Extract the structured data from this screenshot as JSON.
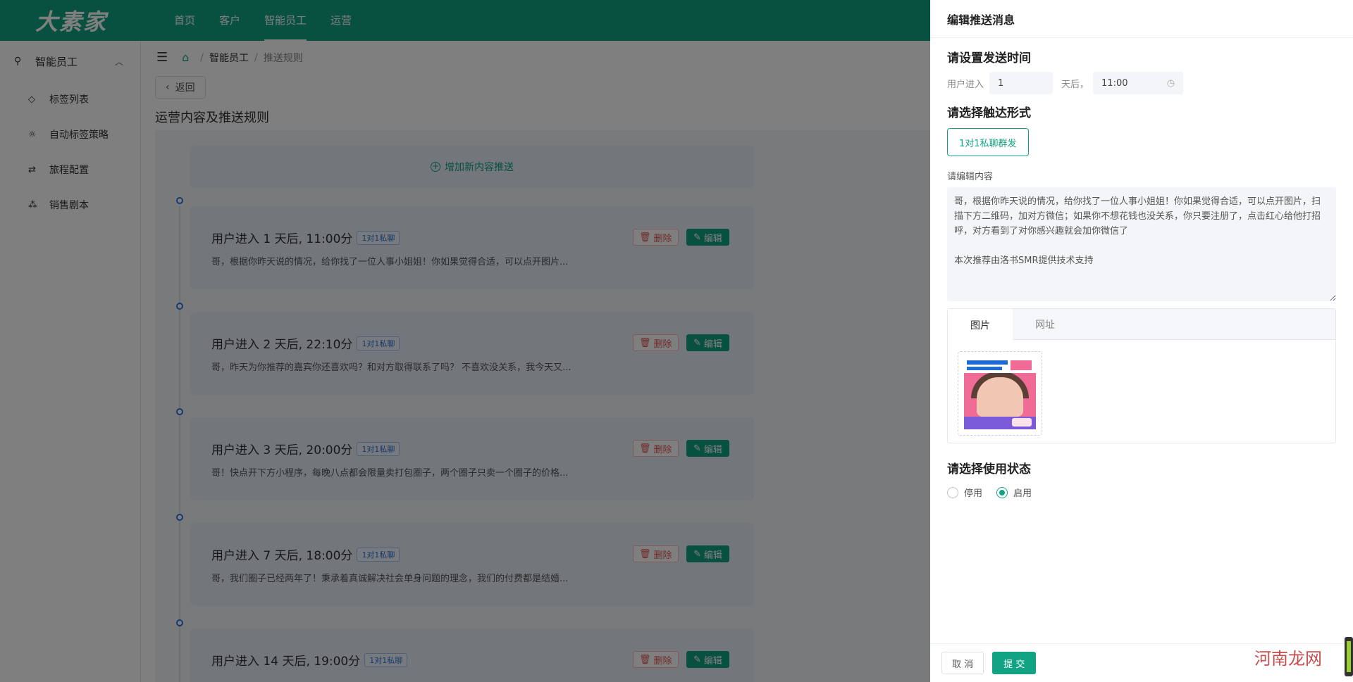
{
  "app": {
    "logo": "大素家",
    "top_nav": [
      "首页",
      "客户",
      "智能员工",
      "运营"
    ],
    "active_nav": "智能员工"
  },
  "sidebar": {
    "group": "智能员工",
    "items": [
      {
        "label": "标签列表",
        "icon": "tag-icon"
      },
      {
        "label": "自动标签策略",
        "icon": "bulb-icon"
      },
      {
        "label": "旅程配置",
        "icon": "route-icon"
      },
      {
        "label": "销售剧本",
        "icon": "tree-icon"
      }
    ]
  },
  "breadcrumb": [
    "智能员工",
    "推送规则"
  ],
  "back_label": "返回",
  "page_title": "运营内容及推送规则",
  "add_push_label": "增加新内容推送",
  "push_cards": [
    {
      "title": "用户进入 1 天后, 11:00分",
      "tag": "1对1私聊",
      "desc": "哥，根据你昨天说的情况，给你找了一位人事小姐姐！你如果觉得合适，可以点开图片..."
    },
    {
      "title": "用户进入 2 天后, 22:10分",
      "tag": "1对1私聊",
      "desc": "哥，昨天为你推荐的嘉宾你还喜欢吗？和对方取得联系了吗？ 不喜欢没关系，我今天又..."
    },
    {
      "title": "用户进入 3 天后, 20:00分",
      "tag": "1对1私聊",
      "desc": "哥！快点开下方小程序，每晚八点都会限量卖打包圈子，两个圈子只卖一个圈子的价格..."
    },
    {
      "title": "用户进入 7 天后, 18:00分",
      "tag": "1对1私聊",
      "desc": "哥，我们圈子已经两年了！秉承着真诚解决社会单身问题的理念，我们的付费都是结婚..."
    },
    {
      "title": "用户进入 14 天后, 19:00分",
      "tag": "1对1私聊",
      "desc": ""
    }
  ],
  "card_actions": {
    "delete": "删除",
    "edit": "编辑"
  },
  "drawer": {
    "title": "编辑推送消息",
    "time_section": "请设置发送时间",
    "user_enter_label": "用户进入",
    "days_value": "1",
    "days_after_label": "天后，",
    "time_value": "11:00",
    "touch_section": "请选择触达形式",
    "touch_option": "1对1私聊群发",
    "content_label": "请编辑内容",
    "content_text": "哥，根据你昨天说的情况，给你找了一位人事小姐姐！你如果觉得合适，可以点开图片，扫描下方二维码，加对方微信；如果你不想花钱也没关系，你只要注册了，点击红心给他打招呼，对方看到了对你感兴趣就会加你微信了\n\n本次推荐由洛书SMR提供技术支持",
    "tabs": [
      "图片",
      "网址"
    ],
    "active_tab": "图片",
    "status_section": "请选择使用状态",
    "status_options": [
      "停用",
      "启用"
    ],
    "status_selected": "启用",
    "cancel": "取 消",
    "submit": "提 交"
  },
  "watermark": "河南龙网",
  "colors": {
    "primary": "#11a383",
    "danger": "#e55353",
    "tag_blue": "#2f74d4"
  }
}
